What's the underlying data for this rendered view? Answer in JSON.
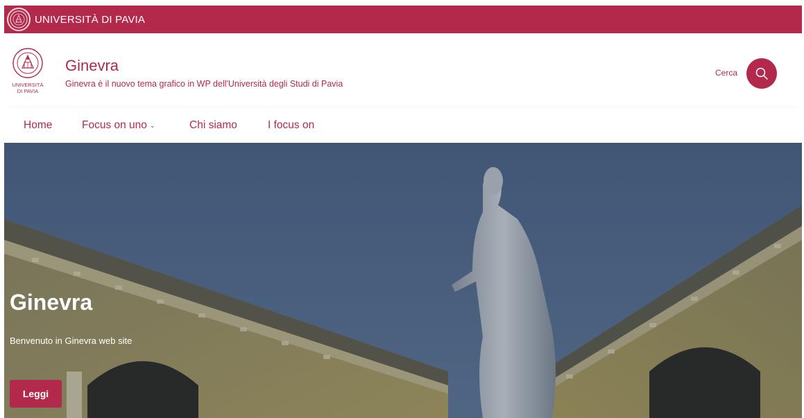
{
  "topbar": {
    "university_name": "UNIVERSITÀ DI PAVIA",
    "seal_icon": "university-seal-icon"
  },
  "header": {
    "logo_line1": "UNIVERSITÀ",
    "logo_line2": "DI PAVIA",
    "site_title": "Ginevra",
    "site_description": "Ginevra è il nuovo tema grafico in WP dell'Università degli Studi di Pavia",
    "search_label": "Cerca",
    "search_icon": "search-icon"
  },
  "nav": {
    "items": [
      {
        "label": "Home"
      },
      {
        "label": "Focus on uno",
        "has_dropdown": true
      },
      {
        "label": "Chi siamo"
      },
      {
        "label": "I focus on"
      }
    ]
  },
  "hero": {
    "title": "Ginevra",
    "subtitle": "Benvenuto in Ginevra web site",
    "button_label": "Leggi"
  },
  "colors": {
    "brand": "#b3294b",
    "white": "#ffffff"
  }
}
